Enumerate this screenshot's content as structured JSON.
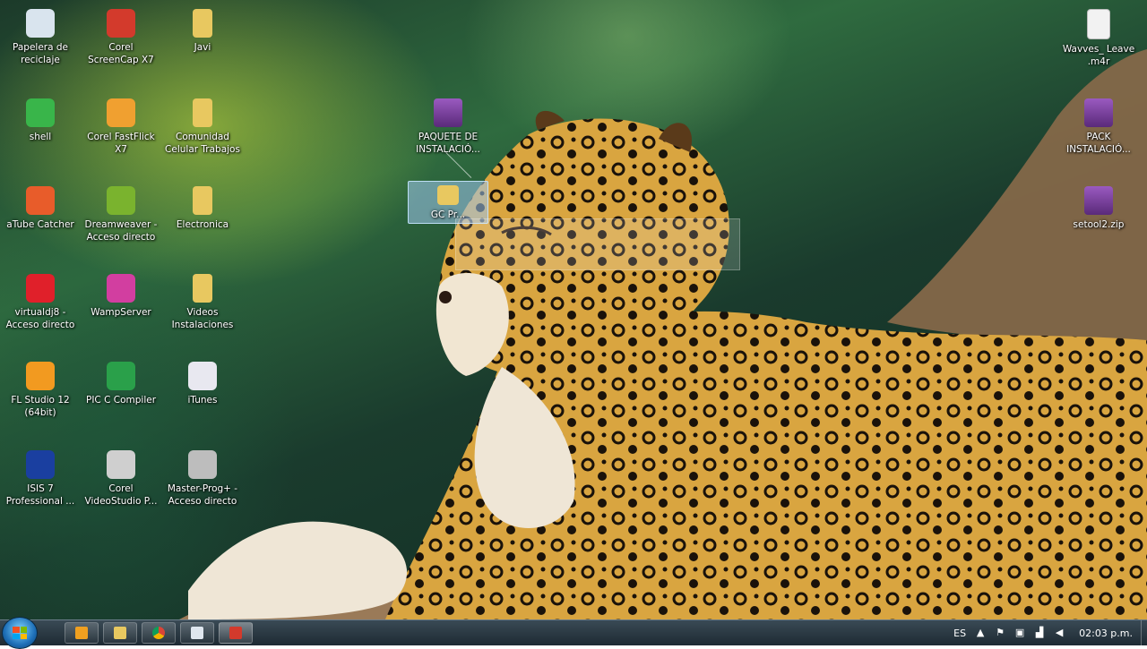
{
  "desktop_icons": [
    {
      "label": "Papelera de reciclaje",
      "icon": "recycle-bin-icon",
      "color": "#d9e4ee"
    },
    {
      "label": "Corel ScreenCap X7",
      "icon": "screencap-icon",
      "color": "#d33a2c"
    },
    {
      "label": "Javi",
      "icon": "folder-icon",
      "color": "#e8c860"
    },
    {
      "label": "shell",
      "icon": "shell-icon",
      "color": "#39b54a"
    },
    {
      "label": "Corel FastFlick X7",
      "icon": "fastflick-icon",
      "color": "#f0a030"
    },
    {
      "label": "Comunidad Celular Trabajos",
      "icon": "folder-icon",
      "color": "#e8c860"
    },
    {
      "label": "aTube Catcher",
      "icon": "atube-icon",
      "color": "#e85c2a"
    },
    {
      "label": "Dreamweaver - Acceso directo",
      "icon": "dreamweaver-icon",
      "color": "#7ab32e"
    },
    {
      "label": "Electronica",
      "icon": "folder-icon",
      "color": "#e8c860"
    },
    {
      "label": "virtualdj8 - Acceso directo",
      "icon": "virtualdj-icon",
      "color": "#e0202a"
    },
    {
      "label": "WampServer",
      "icon": "wampserver-icon",
      "color": "#d23ea0"
    },
    {
      "label": "Videos Instalaciones",
      "icon": "folder-icon",
      "color": "#e8c860"
    },
    {
      "label": "FL Studio 12 (64bit)",
      "icon": "flstudio-icon",
      "color": "#f29a20"
    },
    {
      "label": "PIC C Compiler",
      "icon": "picc-icon",
      "color": "#2aa04a"
    },
    {
      "label": "iTunes",
      "icon": "itunes-icon",
      "color": "#e8e8f0"
    },
    {
      "label": "ISIS 7 Professional ...",
      "icon": "isis-icon",
      "color": "#1a3fa0"
    },
    {
      "label": "Corel VideoStudio P...",
      "icon": "videostudio-icon",
      "color": "#cfcfcf"
    },
    {
      "label": "Master-Prog+ - Acceso directo",
      "icon": "masterprog-icon",
      "color": "#bdbdbd"
    }
  ],
  "right_icons": [
    {
      "label": "Wavves_ Leave .m4r",
      "icon": "audio-file-icon",
      "color": "#f2f2f2"
    },
    {
      "label": "PACK INSTALACIÓ...",
      "icon": "winrar-icon",
      "color": "#7a3a9a"
    },
    {
      "label": "setool2.zip",
      "icon": "winrar-icon",
      "color": "#7a3a9a"
    }
  ],
  "middle_icons": [
    {
      "label": "PAQUETE DE INSTALACIÓ...",
      "icon": "winrar-icon",
      "color": "#7a3a9a"
    }
  ],
  "selected_icon": {
    "label": "GC Pr...",
    "icon": "folder-icon",
    "color": "#e8c860"
  },
  "taskbar": {
    "buttons": [
      {
        "name": "media-player",
        "icon": "media-player-icon",
        "color": "#f0a020"
      },
      {
        "name": "explorer",
        "icon": "folder-icon",
        "color": "#e8c860"
      },
      {
        "name": "chrome",
        "icon": "chrome-icon",
        "color": "#3a9a3a"
      },
      {
        "name": "calculator",
        "icon": "calculator-icon",
        "color": "#dfe6ee"
      },
      {
        "name": "screencap",
        "icon": "screencap-icon",
        "color": "#d33a2c"
      }
    ],
    "tray": {
      "language": "ES",
      "time": "02:03 p.m."
    }
  }
}
